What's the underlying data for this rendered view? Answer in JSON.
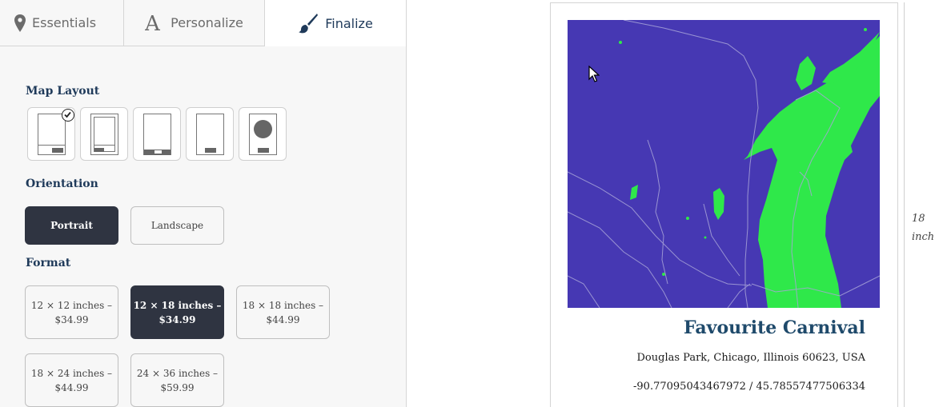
{
  "tabs": [
    {
      "label": "Essentials",
      "icon": "map-pin-icon"
    },
    {
      "label": "Personalize",
      "icon": "font-a-icon"
    },
    {
      "label": "Finalize",
      "icon": "paintbrush-icon",
      "active": true
    }
  ],
  "sections": {
    "map_layout": "Map Layout",
    "orientation": "Orientation",
    "format": "Format"
  },
  "layouts": [
    {
      "name": "bottom-label",
      "selected": true
    },
    {
      "name": "framed-bottom-label"
    },
    {
      "name": "bottom-band"
    },
    {
      "name": "plain-bottom-label"
    },
    {
      "name": "circle-map"
    }
  ],
  "orientation": {
    "options": [
      "Portrait",
      "Landscape"
    ],
    "selected": "Portrait"
  },
  "formats": [
    {
      "size": "12 × 12 inches –",
      "price": "$34.99"
    },
    {
      "size": "12 × 18 inches –",
      "price": "$34.99",
      "selected": true
    },
    {
      "size": "18 × 18 inches –",
      "price": "$44.99"
    },
    {
      "size": "18 × 24 inches –",
      "price": "$44.99"
    },
    {
      "size": "24 × 36 inches –",
      "price": "$59.99"
    }
  ],
  "poster": {
    "title": "Favourite Carnival",
    "address": "Douglas Park, Chicago, Illinois 60623, USA",
    "coordinates": "-90.77095043467972 / 45.78557477506334",
    "map_colors": {
      "water": "#4638b3",
      "land": "#2fe84a",
      "roads": "#a8a4d8"
    }
  },
  "dimension": {
    "value": "18",
    "unit": "inch"
  },
  "colors": {
    "accent": "#2f3441",
    "title": "#1f4a6b"
  }
}
